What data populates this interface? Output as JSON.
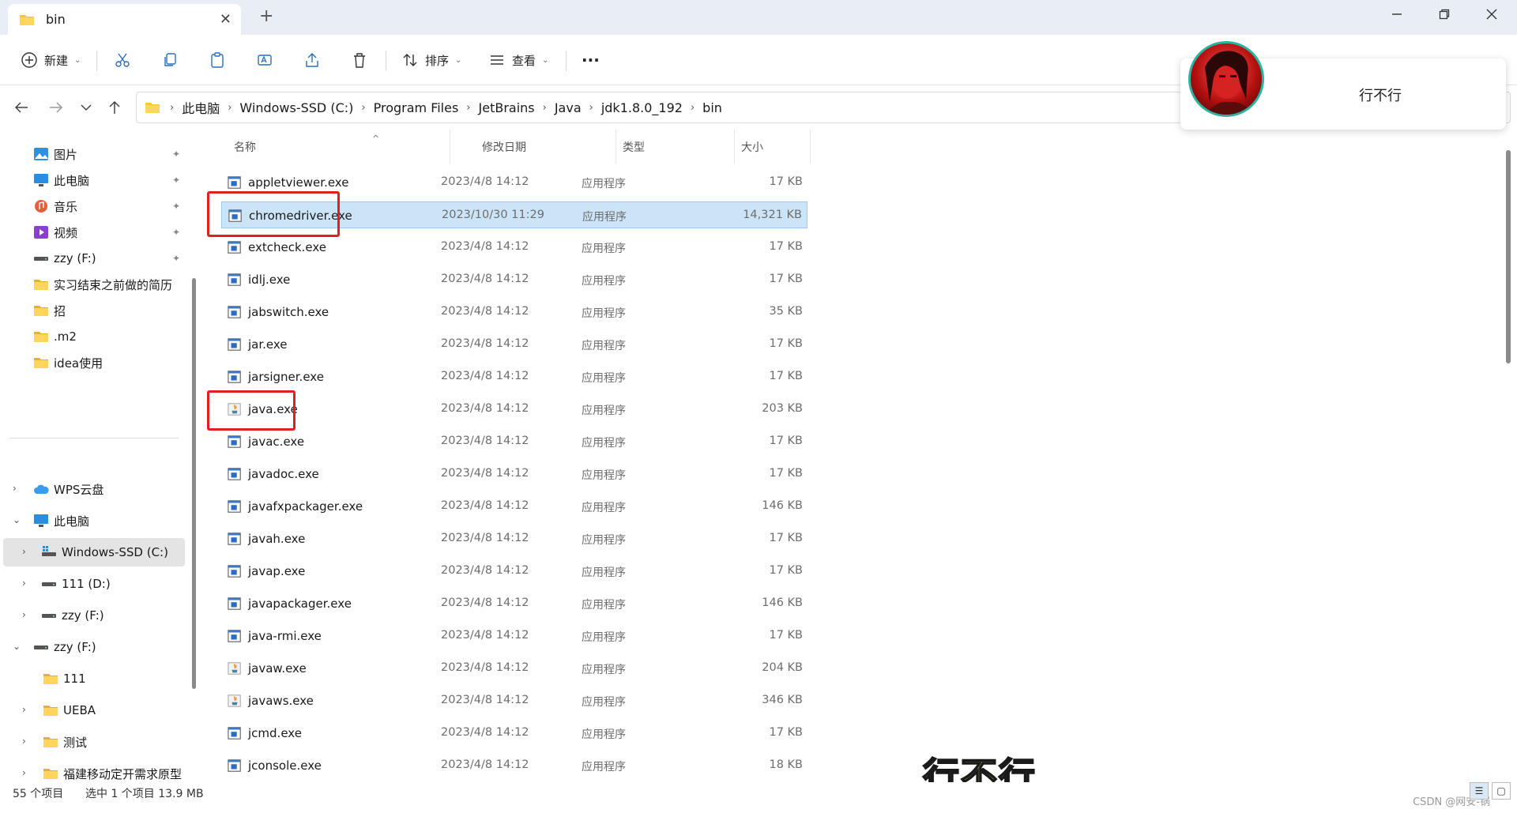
{
  "window": {
    "tab_title": "bin",
    "new_tab": "+",
    "tab_close": "✕"
  },
  "toolbar": {
    "new_label": "新建",
    "sort_label": "排序",
    "view_label": "查看",
    "more_label": "···"
  },
  "address": {
    "crumbs": [
      "此电脑",
      "Windows-SSD (C:)",
      "Program Files",
      "JetBrains",
      "Java",
      "jdk1.8.0_192",
      "bin"
    ]
  },
  "sidebar": {
    "quick": [
      {
        "label": "图片",
        "icon": "pictures-icon"
      },
      {
        "label": "此电脑",
        "icon": "computer-icon"
      },
      {
        "label": "音乐",
        "icon": "music-icon"
      },
      {
        "label": "视频",
        "icon": "video-icon"
      },
      {
        "label": "zzy (F:)",
        "icon": "drive-icon"
      },
      {
        "label": "实习结束之前做的简历",
        "icon": "folder-icon"
      },
      {
        "label": "招",
        "icon": "folder-icon"
      },
      {
        "label": ".m2",
        "icon": "folder-icon"
      },
      {
        "label": "idea使用",
        "icon": "folder-icon"
      }
    ],
    "tree": [
      {
        "label": "WPS云盘",
        "icon": "cloud-icon"
      },
      {
        "label": "此电脑",
        "icon": "computer-icon"
      },
      {
        "label": "Windows-SSD (C:)",
        "icon": "windows-drive-icon"
      },
      {
        "label": "111 (D:)",
        "icon": "drive-icon"
      },
      {
        "label": "zzy (F:)",
        "icon": "drive-icon"
      },
      {
        "label": "zzy (F:)",
        "icon": "drive-icon"
      },
      {
        "label": "111",
        "icon": "folder-icon"
      },
      {
        "label": "UEBA",
        "icon": "folder-icon"
      },
      {
        "label": "测试",
        "icon": "folder-icon"
      },
      {
        "label": "福建移动定开需求原型",
        "icon": "folder-icon"
      }
    ]
  },
  "columns": {
    "name": "名称",
    "date": "修改日期",
    "type": "类型",
    "size": "大小"
  },
  "files": [
    {
      "name": "appletviewer.exe",
      "date": "2023/4/8 14:12",
      "type": "应用程序",
      "size": "17 KB",
      "icon": "exe-icon"
    },
    {
      "name": "chromedriver.exe",
      "date": "2023/10/30 11:29",
      "type": "应用程序",
      "size": "14,321 KB",
      "icon": "exe-icon"
    },
    {
      "name": "extcheck.exe",
      "date": "2023/4/8 14:12",
      "type": "应用程序",
      "size": "17 KB",
      "icon": "exe-icon"
    },
    {
      "name": "idlj.exe",
      "date": "2023/4/8 14:12",
      "type": "应用程序",
      "size": "17 KB",
      "icon": "exe-icon"
    },
    {
      "name": "jabswitch.exe",
      "date": "2023/4/8 14:12",
      "type": "应用程序",
      "size": "35 KB",
      "icon": "exe-icon"
    },
    {
      "name": "jar.exe",
      "date": "2023/4/8 14:12",
      "type": "应用程序",
      "size": "17 KB",
      "icon": "exe-icon"
    },
    {
      "name": "jarsigner.exe",
      "date": "2023/4/8 14:12",
      "type": "应用程序",
      "size": "17 KB",
      "icon": "exe-icon"
    },
    {
      "name": "java.exe",
      "date": "2023/4/8 14:12",
      "type": "应用程序",
      "size": "203 KB",
      "icon": "java-icon"
    },
    {
      "name": "javac.exe",
      "date": "2023/4/8 14:12",
      "type": "应用程序",
      "size": "17 KB",
      "icon": "exe-icon"
    },
    {
      "name": "javadoc.exe",
      "date": "2023/4/8 14:12",
      "type": "应用程序",
      "size": "17 KB",
      "icon": "exe-icon"
    },
    {
      "name": "javafxpackager.exe",
      "date": "2023/4/8 14:12",
      "type": "应用程序",
      "size": "146 KB",
      "icon": "exe-icon"
    },
    {
      "name": "javah.exe",
      "date": "2023/4/8 14:12",
      "type": "应用程序",
      "size": "17 KB",
      "icon": "exe-icon"
    },
    {
      "name": "javap.exe",
      "date": "2023/4/8 14:12",
      "type": "应用程序",
      "size": "17 KB",
      "icon": "exe-icon"
    },
    {
      "name": "javapackager.exe",
      "date": "2023/4/8 14:12",
      "type": "应用程序",
      "size": "146 KB",
      "icon": "exe-icon"
    },
    {
      "name": "java-rmi.exe",
      "date": "2023/4/8 14:12",
      "type": "应用程序",
      "size": "17 KB",
      "icon": "exe-icon"
    },
    {
      "name": "javaw.exe",
      "date": "2023/4/8 14:12",
      "type": "应用程序",
      "size": "204 KB",
      "icon": "java-icon"
    },
    {
      "name": "javaws.exe",
      "date": "2023/4/8 14:12",
      "type": "应用程序",
      "size": "346 KB",
      "icon": "java-icon"
    },
    {
      "name": "jcmd.exe",
      "date": "2023/4/8 14:12",
      "type": "应用程序",
      "size": "17 KB",
      "icon": "exe-icon"
    },
    {
      "name": "jconsole.exe",
      "date": "2023/4/8 14:12",
      "type": "应用程序",
      "size": "18 KB",
      "icon": "exe-icon"
    }
  ],
  "selected_file": "chromedriver.exe",
  "status": {
    "count": "55 个项目",
    "selection": "选中 1 个项目  13.9 MB",
    "watermark": "CSDN @网安-锅"
  },
  "notification": {
    "text": "行不行"
  },
  "caption": "行不行",
  "colors": {
    "selection": "#cce4f7",
    "highlight_box": "#e0201e",
    "folder": "#f4c542"
  }
}
